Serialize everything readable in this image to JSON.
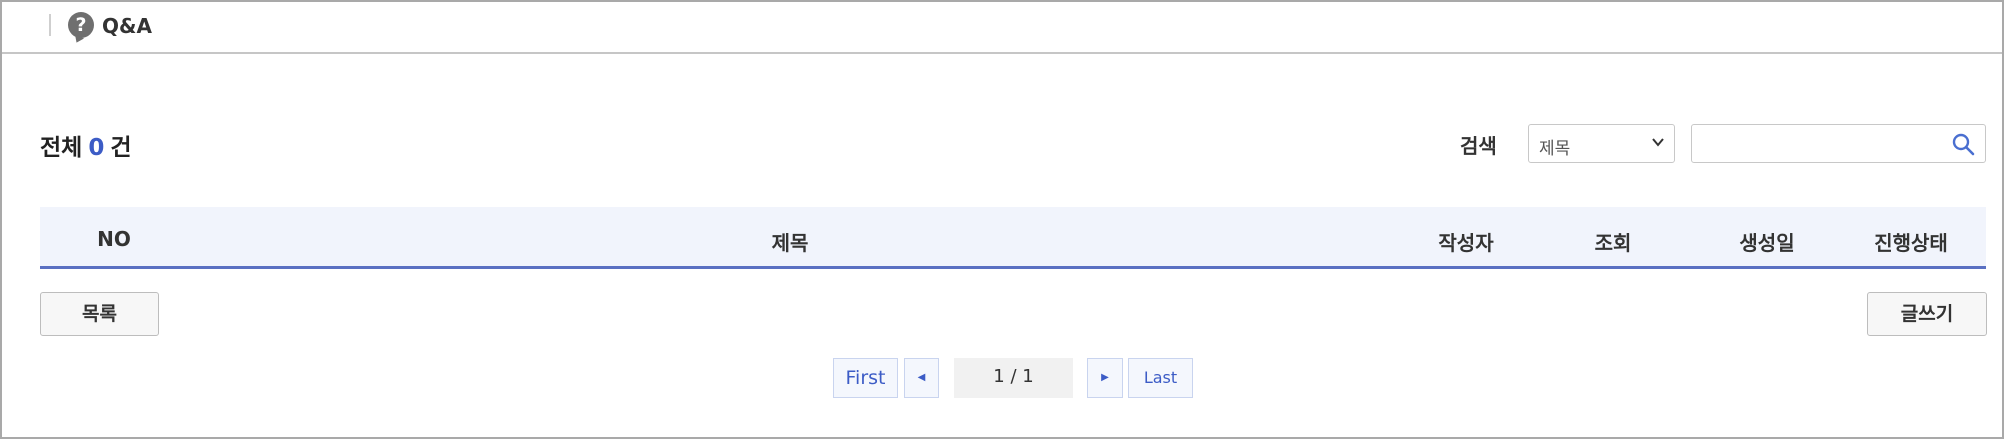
{
  "header": {
    "title": "Q&A",
    "icon": "question-bubble-icon"
  },
  "summary": {
    "prefix": "전체",
    "count": "0",
    "suffix": "건"
  },
  "search": {
    "label": "검색",
    "select_value": "제목",
    "input_value": "",
    "icon": "search-icon"
  },
  "table": {
    "columns": [
      "NO",
      "제목",
      "작성자",
      "조회",
      "생성일",
      "진행상태"
    ],
    "rows": []
  },
  "buttons": {
    "list_label": "목록",
    "write_label": "글쓰기"
  },
  "pagination": {
    "first_label": "First",
    "prev_icon": "prev-arrow-icon",
    "page_info": "1 / 1",
    "next_icon": "next-arrow-icon",
    "last_label": "Last"
  },
  "colors": {
    "accent": "#3c5cc6",
    "header_bg": "#f1f4fc",
    "header_border": "#5a70c2"
  }
}
